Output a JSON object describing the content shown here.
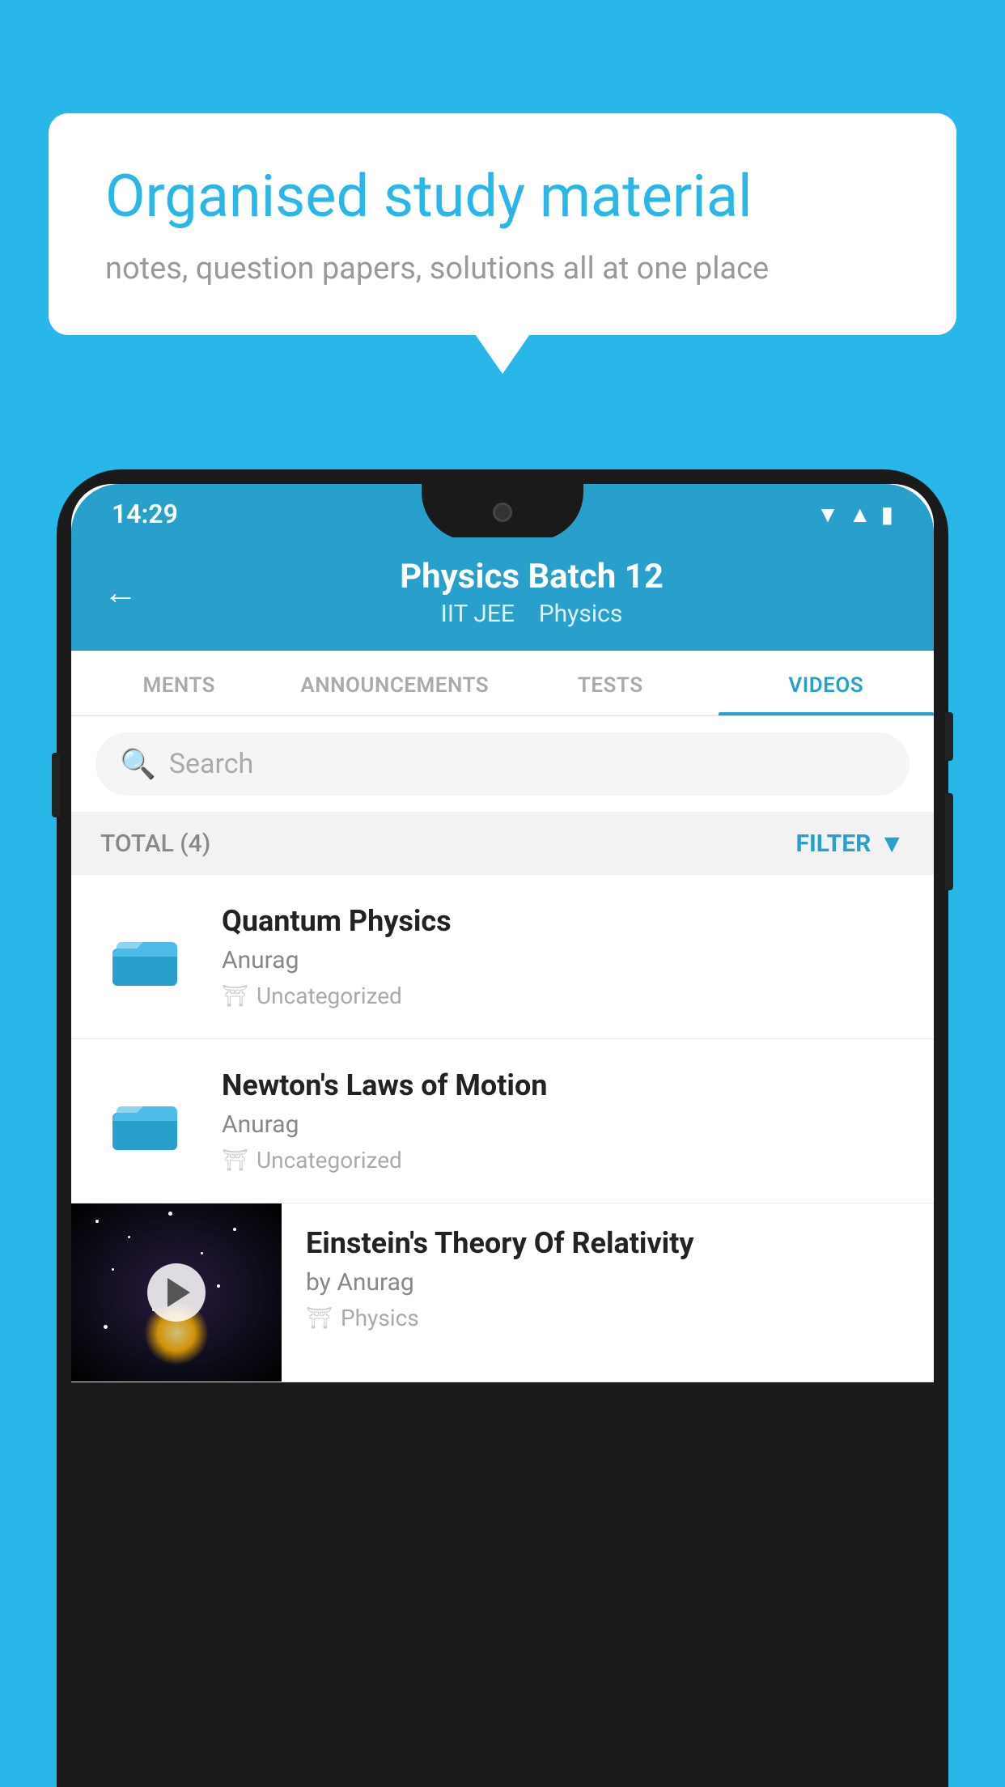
{
  "background_color": "#29b6e8",
  "speech_bubble": {
    "title": "Organised study material",
    "subtitle": "notes, question papers, solutions all at one place"
  },
  "status_bar": {
    "time": "14:29",
    "wifi_icon": "▾",
    "signal_icon": "▲",
    "battery_icon": "▮"
  },
  "app_header": {
    "back_label": "←",
    "title": "Physics Batch 12",
    "subtitle_part1": "IIT JEE",
    "subtitle_part2": "Physics"
  },
  "tabs": [
    {
      "label": "MENTS",
      "active": false
    },
    {
      "label": "ANNOUNCEMENTS",
      "active": false
    },
    {
      "label": "TESTS",
      "active": false
    },
    {
      "label": "VIDEOS",
      "active": true
    }
  ],
  "search": {
    "placeholder": "Search"
  },
  "filter_bar": {
    "total_label": "TOTAL (4)",
    "filter_label": "FILTER"
  },
  "video_items": [
    {
      "title": "Quantum Physics",
      "author": "Anurag",
      "tag": "Uncategorized",
      "type": "folder"
    },
    {
      "title": "Newton's Laws of Motion",
      "author": "Anurag",
      "tag": "Uncategorized",
      "type": "folder"
    },
    {
      "title": "Einstein's Theory Of Relativity",
      "author": "by Anurag",
      "tag": "Physics",
      "type": "video"
    }
  ],
  "colors": {
    "primary": "#29a0cc",
    "accent": "#29b6e8",
    "text_dark": "#222222",
    "text_muted": "#888888",
    "text_light": "#aaaaaa"
  }
}
